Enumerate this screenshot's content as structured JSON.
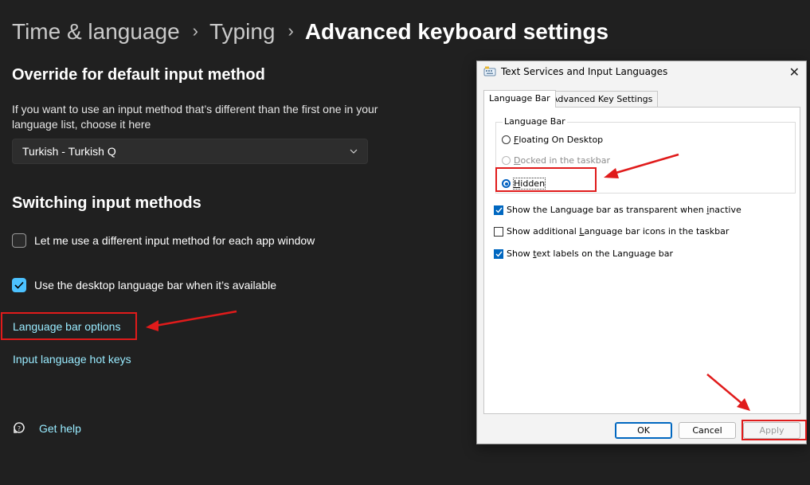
{
  "breadcrumb": {
    "items": [
      "Time & language",
      "Typing"
    ],
    "current": "Advanced keyboard settings",
    "separator": "›"
  },
  "override": {
    "heading": "Override for default input method",
    "description": "If you want to use an input method that’s different than the first one in your language list, choose it here",
    "dropdown_value": "Turkish - Turkish Q"
  },
  "switching": {
    "heading": "Switching input methods",
    "per_app_label": "Let me use a different input method for each app window",
    "per_app_checked": false,
    "desktop_bar_label": "Use the desktop language bar when it’s available",
    "desktop_bar_checked": true
  },
  "links": {
    "language_bar_options": "Language bar options",
    "hot_keys": "Input language hot keys"
  },
  "help": {
    "label": "Get help"
  },
  "dialog": {
    "title": "Text Services and Input Languages",
    "tabs": [
      "Language Bar",
      "Advanced Key Settings"
    ],
    "active_tab": "Language Bar",
    "group_label": "Language Bar",
    "radios": {
      "floating": {
        "accel": "F",
        "rest": "loating On Desktop",
        "selected": false,
        "disabled": false
      },
      "docked": {
        "accel": "D",
        "rest": "ocked in the taskbar",
        "selected": false,
        "disabled": true
      },
      "hidden": {
        "accel": "H",
        "rest": "idden",
        "selected": true,
        "disabled": false
      }
    },
    "checkboxes": {
      "transparent": {
        "pre": "Show the Language bar as transparent when ",
        "accel": "i",
        "post": "nactive",
        "checked": true
      },
      "additional": {
        "pre": "Show additional ",
        "accel": "L",
        "post": "anguage bar icons in the taskbar",
        "checked": false
      },
      "text_labels": {
        "pre": "Show ",
        "accel": "t",
        "post": "ext labels on the Language bar",
        "checked": true
      }
    },
    "buttons": {
      "ok": "OK",
      "cancel": "Cancel",
      "apply": "Apply"
    }
  },
  "colors": {
    "background": "#202020",
    "link": "#99ebff",
    "accent": "#4cc2ff",
    "annotation": "#e01b1b"
  }
}
